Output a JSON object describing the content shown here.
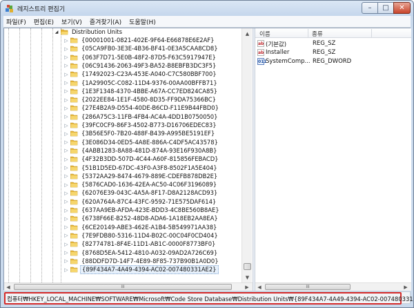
{
  "window": {
    "title": "레지스트리 편집기",
    "close_glyph": "✕",
    "max_glyph": "□",
    "min_glyph": "–"
  },
  "menu": [
    "파일(F)",
    "편집(E)",
    "보기(V)",
    "즐겨찾기(A)",
    "도움말(H)"
  ],
  "tree": {
    "parent": "Distribution Units",
    "expand_glyph": "◢",
    "collapsed_glyph": "▷",
    "items": [
      "{00001001-0821-402E-9F64-E66878E6E2AF}",
      "{05CA9FB0-3E3E-4B36-BF41-0E3A5CAA8CD8}",
      "{063F7D71-5E0B-48F2-87D5-F63C5917947E}",
      "{06C91436-2063-49F3-BA52-B8EBFB3DC3F5}",
      "{17492023-C23A-453E-A040-C7C580BBF700}",
      "{1A29905C-C082-11D4-9376-00AA00BFFB71}",
      "{1E3F1348-4370-4BBE-A67A-CC7ED824CA85}",
      "{2022EE84-1E1F-4580-8D35-FF9DA75366BC}",
      "{27E4B2A9-D554-40DE-B6CD-F11E9B44FBD0}",
      "{286A75C3-11FB-4FB4-AC4A-4DD1B0750050}",
      "{39FC0CF9-86F3-4502-B773-D16706EDEC83}",
      "{3B56E5F0-7B20-488F-B439-A995BE5191EF}",
      "{3E086D34-0ED5-4A8E-886A-C4DF5AC43578}",
      "{4ABB1283-8A88-481D-874A-93E16F930A8B}",
      "{4F32B3DD-507D-4C44-A60F-815856FEBACD}",
      "{51B1D5ED-67DC-43F0-A3F8-8502F1A5E404}",
      "{5372AA29-8474-4679-889E-CDEFB878DB2E}",
      "{5876CAD0-1636-42EA-AC50-4C06F3196089}",
      "{62076E39-043C-4A5A-8F17-D8A2128ACD93}",
      "{620A764A-87C4-43FC-9592-71E575DAF614}",
      "{637AA9EB-AFDA-423E-BDD3-4C8BE560B8AE}",
      "{6738F66E-B252-48D8-ADA6-1A18EB2AA8EA}",
      "{6CE20149-ABE3-462E-A1B4-5B549971AA38}",
      "{7E9FDB80-5316-11D4-B02C-00C04F0CD404}",
      "{82774781-8F4E-11D1-AB1C-0000F8773BF0}",
      "{8768D5EA-5412-4810-A032-09AD2A726C69}",
      "{88DDFD7D-14F7-4E89-8F85-737B90B1A0D0}",
      "{89F434A7-4A49-4394-AC02-007480331AE2}"
    ]
  },
  "list": {
    "columns": [
      "이름",
      "종류"
    ],
    "rows": [
      {
        "icon": "ab",
        "name": "(기본값)",
        "type": "REG_SZ"
      },
      {
        "icon": "ab",
        "name": "Installer",
        "type": "REG_SZ"
      },
      {
        "icon": "011",
        "name": "SystemComp...",
        "type": "REG_DWORD"
      }
    ]
  },
  "scroll": {
    "up": "▲",
    "down": "▼",
    "left": "◀",
    "right": "▶",
    "grip": "III"
  },
  "status": {
    "path": "컴퓨터₩HKEY_LOCAL_MACHINE₩SOFTWARE₩Microsoft₩Code Store Database₩Distribution Units₩{89F434A7-4A49-4394-AC02-007480331AE2}"
  },
  "colors": {
    "folder": "#e8b73a",
    "highlight": "#d42a2a"
  }
}
